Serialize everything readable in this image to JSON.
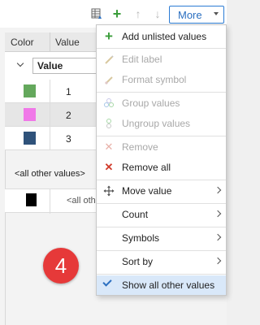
{
  "toolbar": {
    "icons": [
      "table-icon",
      "add-icon",
      "move-up-icon",
      "move-down-icon"
    ],
    "more_label": "More"
  },
  "table": {
    "columns": [
      "Color",
      "Value"
    ],
    "field_value": "Value",
    "rows": [
      {
        "color": "#64a85c",
        "value": "1"
      },
      {
        "color": "#f078e8",
        "value": "2"
      },
      {
        "color": "#2f527a",
        "value": "3"
      }
    ],
    "others_heading": "<all other values>",
    "others_row": {
      "color": "#000000",
      "value": "<all othe"
    }
  },
  "badge": "4",
  "menu": {
    "items": [
      {
        "label": "Add unlisted values",
        "icon": "plus-icon",
        "enabled": true
      },
      {
        "label": "Edit label",
        "icon": "pencil-icon",
        "enabled": false
      },
      {
        "label": "Format symbol",
        "icon": "brush-icon",
        "enabled": false
      },
      {
        "label": "Group values",
        "icon": "group-icon",
        "enabled": false
      },
      {
        "label": "Ungroup values",
        "icon": "ungroup-icon",
        "enabled": false
      },
      {
        "label": "Remove",
        "icon": "remove-icon",
        "enabled": false
      },
      {
        "label": "Remove all",
        "icon": "remove-all-icon",
        "enabled": true
      },
      {
        "label": "Move value",
        "icon": "move-icon",
        "enabled": true
      },
      {
        "label": "Count",
        "enabled": true
      },
      {
        "label": "Symbols",
        "enabled": true
      },
      {
        "label": "Sort by",
        "enabled": true
      },
      {
        "label": "Show all other values",
        "enabled": true,
        "checked": true
      }
    ]
  },
  "colors": {
    "accent": "#2b6fc0",
    "add_green": "#3a9d3a",
    "remove_red": "#d03a2a",
    "badge_red": "#e63939"
  }
}
